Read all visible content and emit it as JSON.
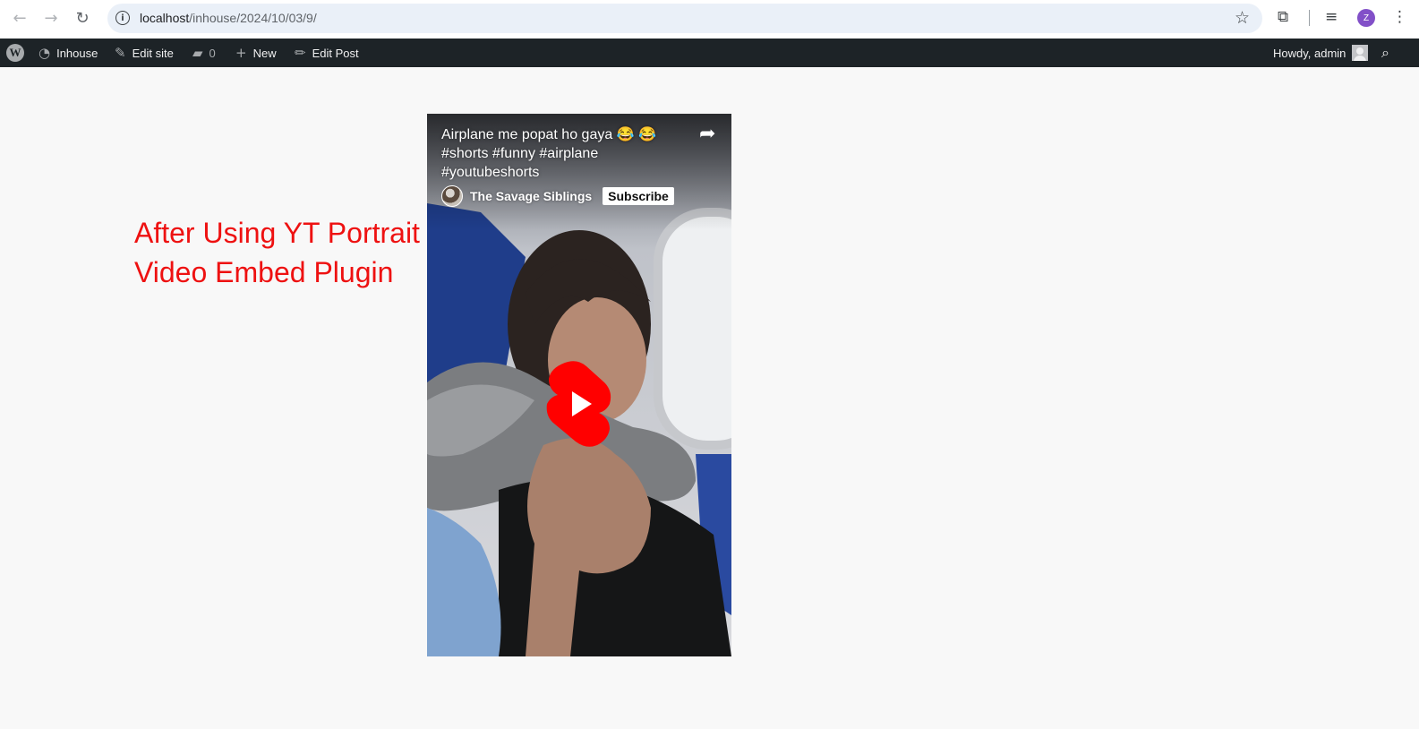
{
  "browser": {
    "url_host": "localhost",
    "url_path": "/inhouse/2024/10/03/9/",
    "profile_initial": "Z"
  },
  "admin_bar": {
    "site_name": "Inhouse",
    "edit_site": "Edit site",
    "comments_count": "0",
    "new_label": "New",
    "edit_post": "Edit Post",
    "greeting": "Howdy, admin"
  },
  "content": {
    "heading": "After Using YT Portrait Video Embed Plugin"
  },
  "video": {
    "title": "Airplane me popat ho gaya 😂 😂 #shorts #funny #airplane #youtubeshorts",
    "channel": "The Savage Siblings",
    "subscribe_label": "Subscribe"
  },
  "colors": {
    "admin_bar_bg": "#1d2327",
    "heading": "#ee1111",
    "play_button": "#ff0000",
    "omnibox_bg": "#eaf0f8"
  }
}
